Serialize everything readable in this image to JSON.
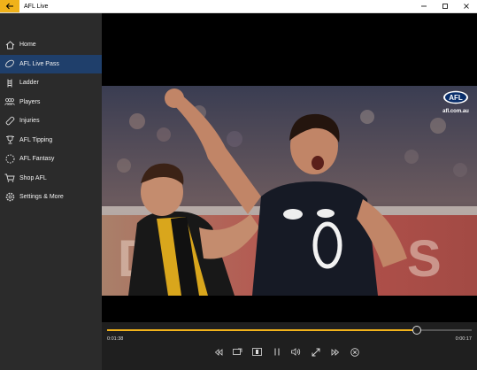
{
  "window": {
    "title": "AFL Live",
    "back_icon": "back-arrow-icon",
    "accent": "#f0b21a",
    "controls": [
      "minimize-icon",
      "maximize-icon",
      "close-icon"
    ]
  },
  "sidebar": {
    "selected_color": "#1f3f6b",
    "items": [
      {
        "label": "Home",
        "icon": "home-icon"
      },
      {
        "label": "AFL Live Pass",
        "icon": "football-icon",
        "selected": true
      },
      {
        "label": "Ladder",
        "icon": "ladder-icon"
      },
      {
        "label": "Players",
        "icon": "players-icon"
      },
      {
        "label": "Injuries",
        "icon": "bandage-icon"
      },
      {
        "label": "AFL Tipping",
        "icon": "trophy-icon"
      },
      {
        "label": "AFL Fantasy",
        "icon": "dotted-circle-icon"
      },
      {
        "label": "Shop AFL",
        "icon": "cart-icon"
      },
      {
        "label": "Settings & More",
        "icon": "gear-icon"
      }
    ]
  },
  "player": {
    "logo_text": "AFL",
    "site": "afl.com.au",
    "current_time": "0:01:38",
    "remaining_time": "0:00:17",
    "progress": 0.85,
    "accent": "#f2b31b",
    "buttons": [
      "skip-back-icon",
      "cast-icon",
      "picture-in-picture-icon",
      "pause-icon",
      "volume-icon",
      "fullscreen-icon",
      "skip-forward-icon",
      "exit-icon"
    ]
  }
}
